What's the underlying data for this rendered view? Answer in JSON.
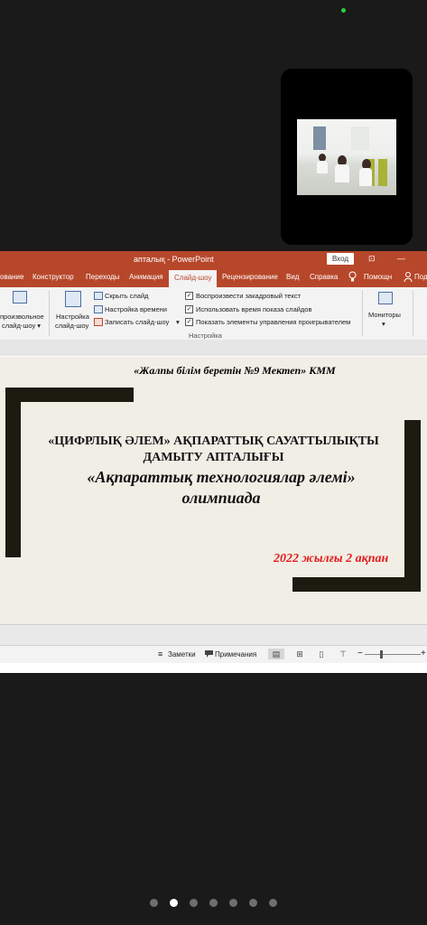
{
  "window": {
    "title": "апталық  -  PowerPoint",
    "signin_label": "Вход",
    "restore_glyph": "⊡",
    "minimize_glyph": "—"
  },
  "tabs": [
    "ование",
    "Конструктор",
    "Переходы",
    "Анимация",
    "Слайд-шоу",
    "Рецензирование",
    "Вид",
    "Справка",
    "Помощн",
    "Поде"
  ],
  "active_tab": "Слайд-шоу",
  "ribbon": {
    "custom_show_line1": "произвольное",
    "custom_show_line2": "слайд-шоу ▾",
    "setup_line1": "Настройка",
    "setup_line2": "слайд-шоу",
    "hide_slide": "Скрыть слайд",
    "rehearse_timings": "Настройка времени",
    "record_slideshow": "Записать слайд-шоу",
    "record_arrow": "▾",
    "play_narrations": "Воспроизвести закадровый текст",
    "use_timings": "Использовать время показа слайдов",
    "show_media_controls": "Показать элементы управления проигрывателем",
    "group_label": "Настройка",
    "monitors_label": "Мониторы",
    "monitors_arrow": "▾"
  },
  "slide": {
    "org": "«Жалпы білім беретін №9 Мектеп» КММ",
    "title_line1": "«ЦИФРЛЫҚ ӘЛЕМ» АҚПАРАТТЫҚ САУАТТЫЛЫҚТЫ",
    "title_line2": "ДАМЫТУ АПТАЛЫҒЫ",
    "subtitle_line1": "«Ақпараттық технологиялар әлемі»",
    "subtitle_line2": "олимпиада",
    "date": "2022 жылғы 2 ақпан"
  },
  "status": {
    "notes_label": "Заметки",
    "comments_label": "Примечания",
    "zoom_minus": "−",
    "zoom_plus": "+"
  },
  "pager": {
    "total_pages": 7,
    "active_page": 2
  },
  "colors": {
    "accent": "#b7472a",
    "slide_bg": "#f1eee6",
    "bracket": "#1c1b10",
    "date_red": "#e21b1b"
  }
}
